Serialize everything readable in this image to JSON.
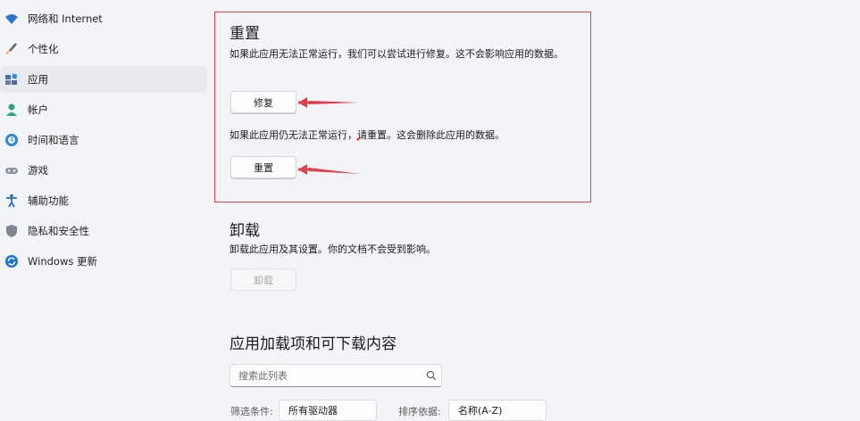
{
  "sidebar": {
    "items": [
      {
        "label": "网络和 Internet",
        "icon": "wifi-icon"
      },
      {
        "label": "个性化",
        "icon": "brush-icon"
      },
      {
        "label": "应用",
        "icon": "apps-icon",
        "selected": true
      },
      {
        "label": "帐户",
        "icon": "person-icon"
      },
      {
        "label": "时间和语言",
        "icon": "globe-clock-icon"
      },
      {
        "label": "游戏",
        "icon": "gamepad-icon"
      },
      {
        "label": "辅助功能",
        "icon": "accessibility-icon"
      },
      {
        "label": "隐私和安全性",
        "icon": "shield-icon"
      },
      {
        "label": "Windows 更新",
        "icon": "windows-update-icon"
      }
    ]
  },
  "reset_section": {
    "title": "重置",
    "repair_description": "如果此应用无法正常运行，我们可以尝试进行修复。这不会影响应用的数据。",
    "repair_button": "修复",
    "reset_description": "如果此应用仍无法正常运行，请重置。这会删除此应用的数据。",
    "reset_button": "重置"
  },
  "uninstall_section": {
    "title": "卸载",
    "description": "卸载此应用及其设置。你的文档不会受到影响。",
    "button": "卸载"
  },
  "addons_section": {
    "title": "应用加载项和可下载内容",
    "search_placeholder": "搜索此列表",
    "filter_label": "筛选条件:",
    "filter_value": "所有驱动器",
    "sort_label": "排序依据:",
    "sort_value": "名称(A-Z)"
  },
  "colors": {
    "annotation_red": "#e0404a",
    "accent_blue": "#0067c0"
  }
}
